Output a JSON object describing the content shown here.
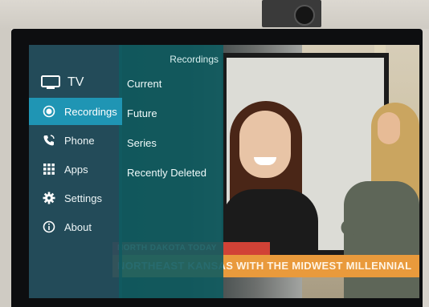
{
  "menu": {
    "items": [
      {
        "label": "TV",
        "icon": "tv-icon"
      },
      {
        "label": "Recordings",
        "icon": "record-icon",
        "active": true
      },
      {
        "label": "Phone",
        "icon": "phone-icon"
      },
      {
        "label": "Apps",
        "icon": "apps-grid-icon"
      },
      {
        "label": "Settings",
        "icon": "gear-icon"
      },
      {
        "label": "About",
        "icon": "info-icon"
      }
    ]
  },
  "submenu": {
    "title": "Recordings",
    "items": [
      "Current",
      "Future",
      "Series",
      "Recently Deleted"
    ]
  },
  "broadcast": {
    "chyron_small": "NORTH DAKOTA TODAY",
    "chyron_main": "NORTHEAST KANSAS WITH THE MIDWEST MILLENNIAL"
  },
  "colors": {
    "menu_bg": "#244e5c",
    "submenu_bg": "#105c60",
    "active_item": "#1f95b4",
    "chyron_red": "#d14236",
    "chyron_orange": "#e99a3c"
  }
}
